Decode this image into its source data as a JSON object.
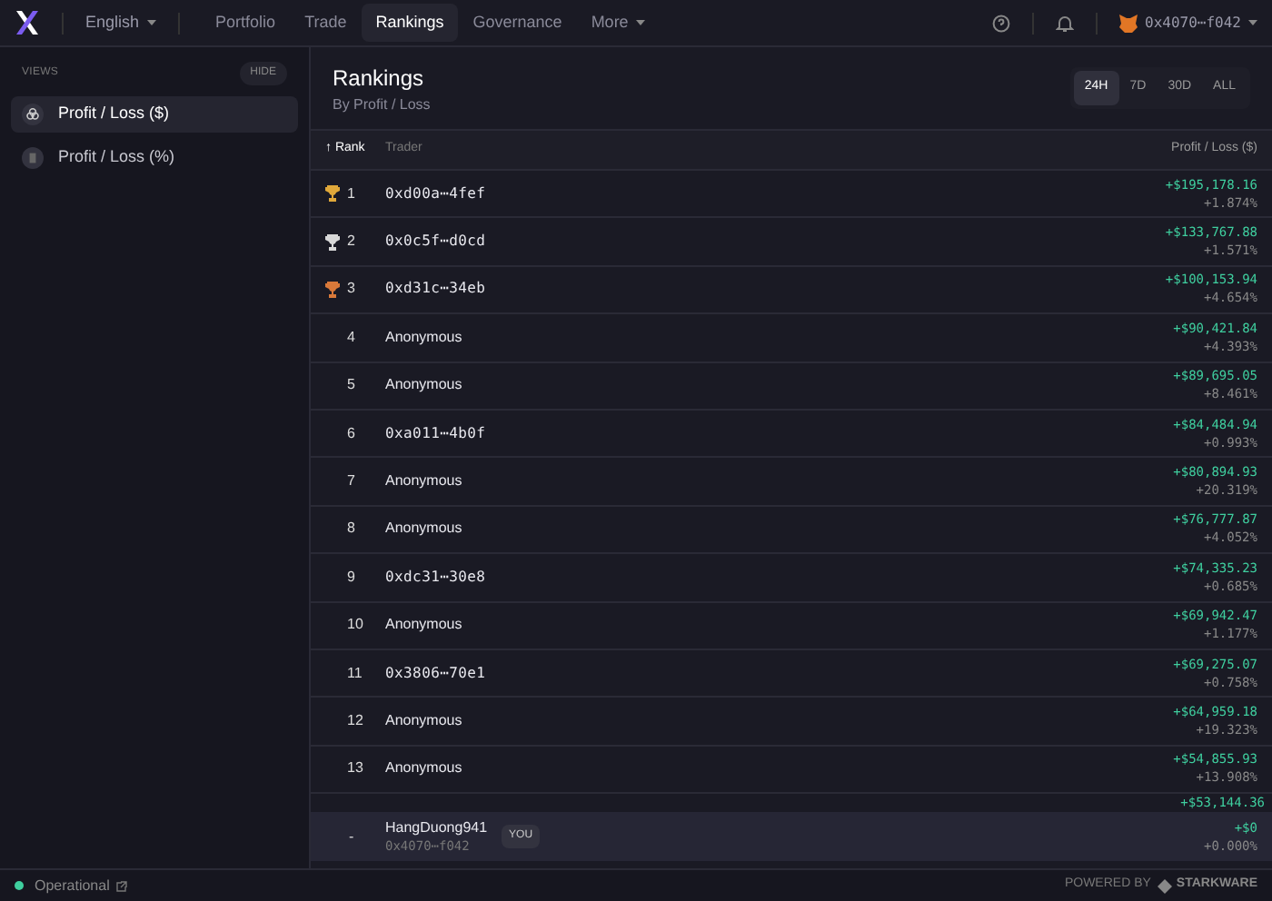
{
  "nav": {
    "language": "English",
    "items": [
      {
        "label": "Portfolio",
        "selected": false
      },
      {
        "label": "Trade",
        "selected": false
      },
      {
        "label": "Rankings",
        "selected": true
      },
      {
        "label": "Governance",
        "selected": false
      },
      {
        "label": "More",
        "selected": false,
        "dropdown": true
      }
    ],
    "wallet": "0x4070⋯f042"
  },
  "sidebar": {
    "heading": "VIEWS",
    "hide": "HIDE",
    "items": [
      {
        "label": "Profit / Loss ($)",
        "selected": true
      },
      {
        "label": "Profit / Loss (%)",
        "selected": false
      }
    ]
  },
  "header": {
    "title": "Rankings",
    "subtitle": "By Profit / Loss",
    "periods": [
      {
        "label": "24H",
        "selected": true
      },
      {
        "label": "7D",
        "selected": false
      },
      {
        "label": "30D",
        "selected": false
      },
      {
        "label": "ALL",
        "selected": false
      }
    ]
  },
  "table": {
    "columns": [
      "↑ Rank",
      "Trader",
      "Profit / Loss ($)"
    ],
    "rows": [
      {
        "rank": "1",
        "color": "#e0a83a",
        "trader": "0xd00a⋯4fef",
        "kind": "address",
        "pnl": "+$195,178.16",
        "pct": "+1.874%"
      },
      {
        "rank": "2",
        "color": "#d8d8d8",
        "trader": "0x0c5f⋯d0cd",
        "kind": "address",
        "pnl": "+$133,767.88",
        "pct": "+1.571%"
      },
      {
        "rank": "3",
        "color": "#d9793a",
        "trader": "0xd31c⋯34eb",
        "kind": "address",
        "pnl": "+$100,153.94",
        "pct": "+4.654%"
      },
      {
        "rank": "4",
        "trader": "Anonymous",
        "kind": "name",
        "pnl": "+$90,421.84",
        "pct": "+4.393%"
      },
      {
        "rank": "5",
        "trader": "Anonymous",
        "kind": "name",
        "pnl": "+$89,695.05",
        "pct": "+8.461%"
      },
      {
        "rank": "6",
        "trader": "0xa011⋯4b0f",
        "kind": "address",
        "pnl": "+$84,484.94",
        "pct": "+0.993%"
      },
      {
        "rank": "7",
        "trader": "Anonymous",
        "kind": "name",
        "pnl": "+$80,894.93",
        "pct": "+20.319%"
      },
      {
        "rank": "8",
        "trader": "Anonymous",
        "kind": "name",
        "pnl": "+$76,777.87",
        "pct": "+4.052%"
      },
      {
        "rank": "9",
        "trader": "0xdc31⋯30e8",
        "kind": "address",
        "pnl": "+$74,335.23",
        "pct": "+0.685%"
      },
      {
        "rank": "10",
        "trader": "Anonymous",
        "kind": "name",
        "pnl": "+$69,942.47",
        "pct": "+1.177%"
      },
      {
        "rank": "11",
        "trader": "0x3806⋯70e1",
        "kind": "address",
        "pnl": "+$69,275.07",
        "pct": "+0.758%"
      },
      {
        "rank": "12",
        "trader": "Anonymous",
        "kind": "name",
        "pnl": "+$64,959.18",
        "pct": "+19.323%"
      },
      {
        "rank": "13",
        "trader": "Anonymous",
        "kind": "name",
        "pnl": "+$54,855.93",
        "pct": "+13.908%"
      },
      {
        "pnl": "+$53,144.36",
        "kind": "partial"
      }
    ],
    "you": {
      "rank": "-",
      "name": "HangDuong941",
      "address": "0x4070⋯f042",
      "badge": "YOU",
      "pnl": "+$0",
      "pct": "+0.000%"
    }
  },
  "status_bar": {
    "status": "Operational",
    "powered": "POWERED BY",
    "brand": "STARKWARE"
  }
}
